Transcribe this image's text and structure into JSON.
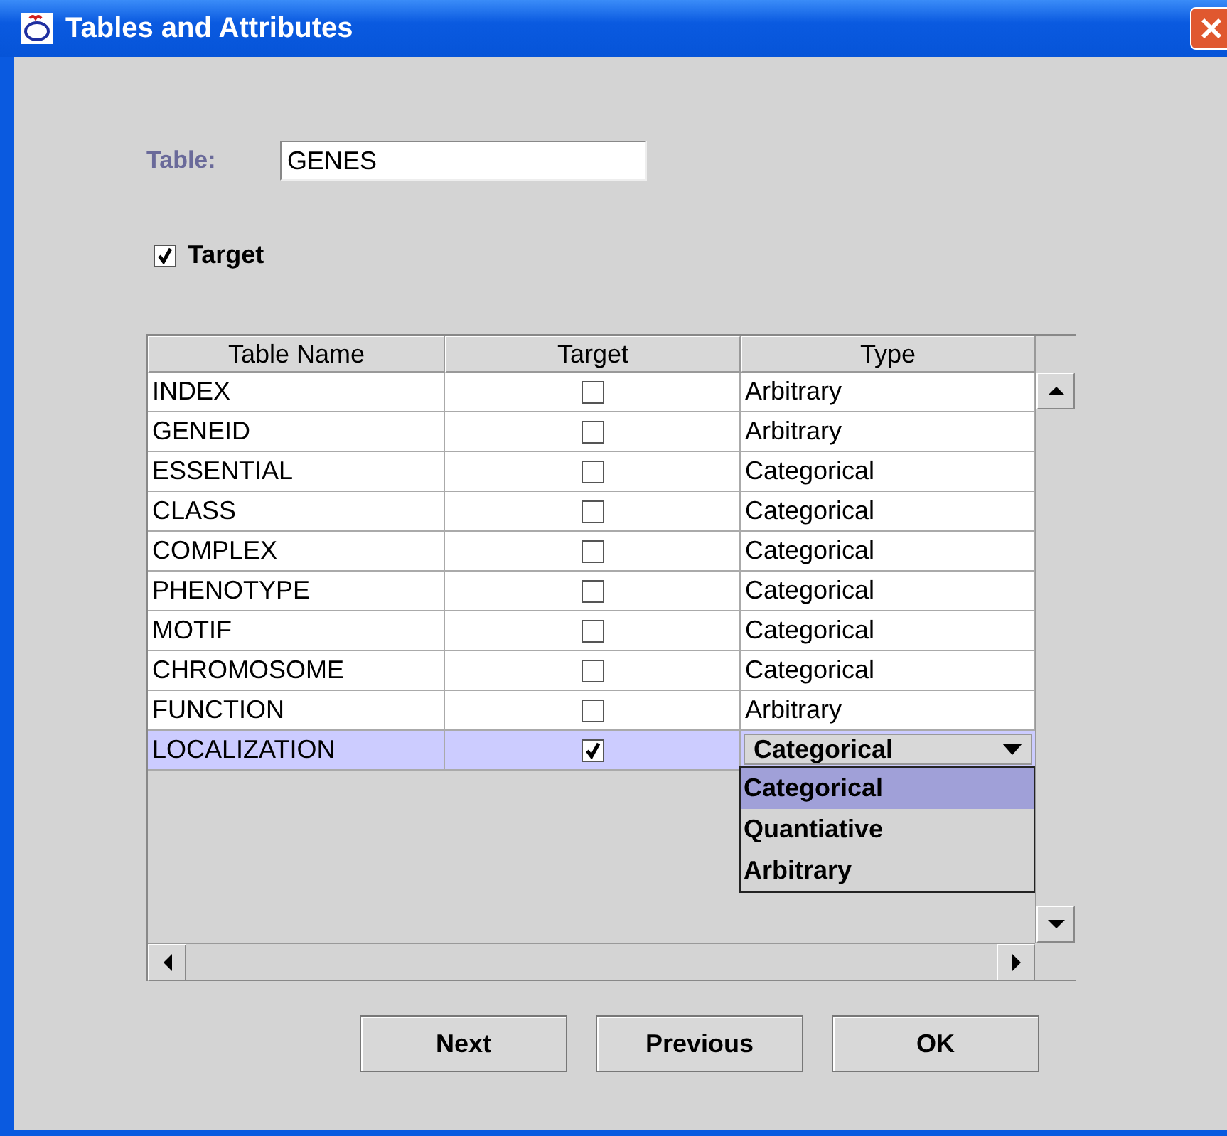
{
  "window": {
    "title": "Tables and Attributes"
  },
  "table_field": {
    "label": "Table:",
    "value": "GENES"
  },
  "target_checkbox": {
    "label": "Target",
    "checked": true
  },
  "table": {
    "columns": [
      "Table Name",
      "Target",
      "Type"
    ],
    "rows": [
      {
        "name": "INDEX",
        "target": false,
        "type": "Arbitrary",
        "selected": false,
        "kind": "text"
      },
      {
        "name": "GENEID",
        "target": false,
        "type": "Arbitrary",
        "selected": false,
        "kind": "text"
      },
      {
        "name": "ESSENTIAL",
        "target": false,
        "type": "Categorical",
        "selected": false,
        "kind": "text"
      },
      {
        "name": "CLASS",
        "target": false,
        "type": "Categorical",
        "selected": false,
        "kind": "text"
      },
      {
        "name": "COMPLEX",
        "target": false,
        "type": "Categorical",
        "selected": false,
        "kind": "text"
      },
      {
        "name": "PHENOTYPE",
        "target": false,
        "type": "Categorical",
        "selected": false,
        "kind": "text"
      },
      {
        "name": "MOTIF",
        "target": false,
        "type": "Categorical",
        "selected": false,
        "kind": "text"
      },
      {
        "name": "CHROMOSOME",
        "target": false,
        "type": "Categorical",
        "selected": false,
        "kind": "text"
      },
      {
        "name": "FUNCTION",
        "target": false,
        "type": "Arbitrary",
        "selected": false,
        "kind": "text"
      },
      {
        "name": "LOCALIZATION",
        "target": true,
        "type": "Categorical",
        "selected": true,
        "kind": "combo"
      }
    ],
    "dropdown_options": [
      {
        "label": "Categorical",
        "selected": true
      },
      {
        "label": "Quantiative",
        "selected": false
      },
      {
        "label": "Arbitrary",
        "selected": false
      }
    ]
  },
  "buttons": [
    "Next",
    "Previous",
    "OK"
  ]
}
